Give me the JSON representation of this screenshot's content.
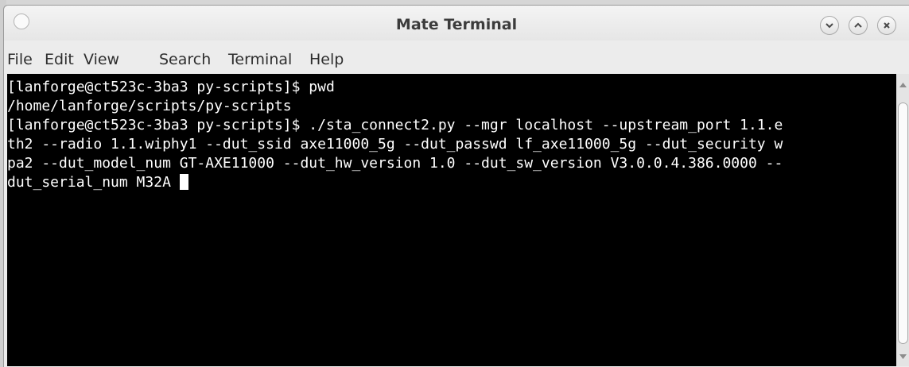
{
  "window": {
    "title": "Mate Terminal"
  },
  "window_controls": {
    "icons": [
      "minimize-icon",
      "maximize-icon",
      "close-icon"
    ]
  },
  "menubar": {
    "items": [
      {
        "label": "File"
      },
      {
        "label": "Edit"
      },
      {
        "label": "View"
      },
      {
        "label": "Search"
      },
      {
        "label": "Terminal"
      },
      {
        "label": "Help"
      }
    ]
  },
  "terminal": {
    "lines": [
      "[lanforge@ct523c-3ba3 py-scripts]$ pwd",
      "/home/lanforge/scripts/py-scripts",
      "[lanforge@ct523c-3ba3 py-scripts]$ ./sta_connect2.py --mgr localhost --upstream_port 1.1.e",
      "th2 --radio 1.1.wiphy1 --dut_ssid axe11000_5g --dut_passwd lf_axe11000_5g --dut_security w",
      "pa2 --dut_model_num GT-AXE11000 --dut_hw_version 1.0 --dut_sw_version V3.0.0.4.386.0000 --",
      "dut_serial_num M32A "
    ],
    "colors": {
      "background": "#000000",
      "foreground": "#ffffff"
    }
  }
}
